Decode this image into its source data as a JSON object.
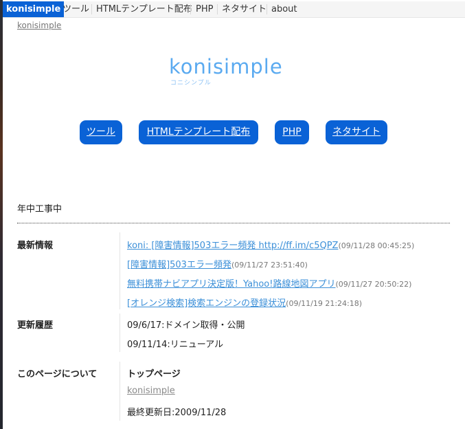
{
  "topnav": {
    "home": "konisimple",
    "items": [
      "ツール",
      "HTMLテンプレート配布",
      "PHP",
      "ネタサイト",
      "about"
    ]
  },
  "breadcrumb": "konisimple",
  "logo": {
    "title": "konisimple",
    "subtitle": "コニシンプル"
  },
  "main_nav": [
    "ツール",
    "HTMLテンプレート配布",
    "PHP",
    "ネタサイト"
  ],
  "tagline": "年中工事中",
  "sections": {
    "news": {
      "heading": "最新情報",
      "items": [
        {
          "text": "koni: [障害情報]503エラー頻発 http://ff.im/c5QPZ",
          "time": "(09/11/28 00:45:25)"
        },
        {
          "text": "[障害情報]503エラー頻発",
          "time": "(09/11/27 23:51:40)"
        },
        {
          "text": "無料携帯ナビアプリ決定版！Yahoo!路線地図アプリ",
          "time": "(09/11/27 20:50:22)"
        },
        {
          "text": "[オレンジ検索]検索エンジンの登録状況",
          "time": "(09/11/19 21:24:18)"
        }
      ]
    },
    "history": {
      "heading": "更新履歴",
      "items": [
        "09/6/17:ドメイン取得・公開",
        "09/11/14:リニューアル"
      ]
    },
    "about": {
      "heading": "このページについて",
      "page_title": "トップページ",
      "link": "konisimple",
      "updated": "最終更新日:2009/11/28"
    }
  },
  "colors": {
    "accent": "#0a62d6",
    "link": "#3b8fd8",
    "logo": "#5aaaf0"
  }
}
